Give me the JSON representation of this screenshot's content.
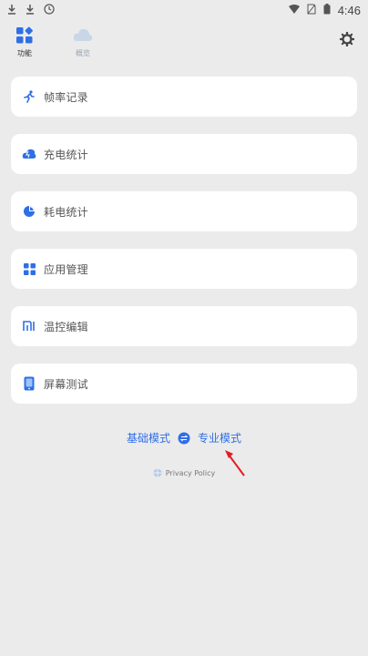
{
  "status": {
    "time": "4:46",
    "left_icons": [
      "download-icon",
      "download-icon",
      "clock-icon"
    ],
    "right_icons": [
      "wifi-icon",
      "no-sim-icon",
      "battery-icon"
    ]
  },
  "tabs": [
    {
      "label": "功能",
      "icon": "function-grid-icon",
      "active": true
    },
    {
      "label": "概览",
      "icon": "cloud-icon",
      "active": false
    }
  ],
  "settings": {
    "icon": "gear-icon"
  },
  "cards": [
    {
      "label": "帧率记录",
      "icon": "running-icon"
    },
    {
      "label": "充电统计",
      "icon": "charging-icon"
    },
    {
      "label": "耗电统计",
      "icon": "pie-chart-icon"
    },
    {
      "label": "应用管理",
      "icon": "app-grid-icon"
    },
    {
      "label": "温控编辑",
      "icon": "mi-logo-icon"
    },
    {
      "label": "屏幕测试",
      "icon": "phone-screen-icon"
    }
  ],
  "mode": {
    "basic": "基础模式",
    "pro": "专业模式",
    "switch_icon": "switch-arrows-icon"
  },
  "privacy": {
    "label": "Privacy Policy",
    "icon": "globe-icon"
  },
  "colors": {
    "background": "#ebebeb",
    "card": "#ffffff",
    "accent": "#2f6fe6",
    "arrow": "#e11d25"
  }
}
